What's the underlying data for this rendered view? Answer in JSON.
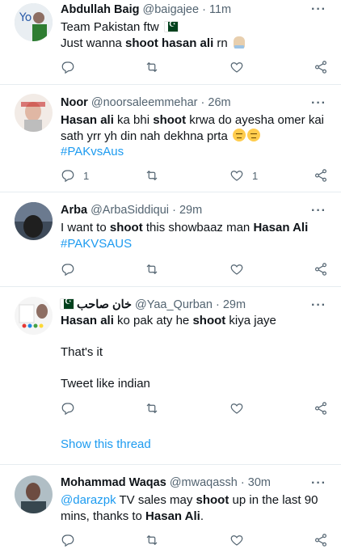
{
  "tweets": [
    {
      "name": "Abdullah Baig",
      "handle": "@baigajee",
      "time": "11m",
      "lines": [
        [
          {
            "t": "Team Pakistan ftw ",
            "s": ""
          },
          {
            "t": "pk-flag",
            "s": "flag"
          }
        ],
        [
          {
            "t": "Just wanna ",
            "s": ""
          },
          {
            "t": "shoot hasan ali",
            "s": "b"
          },
          {
            "t": " rn ",
            "s": ""
          },
          {
            "t": "folded-hands",
            "s": "hands"
          }
        ]
      ],
      "reply_count": "",
      "like_count": ""
    },
    {
      "name": "Noor",
      "handle": "@noorsaleemmehar",
      "time": "26m",
      "lines": [
        [
          {
            "t": "Hasan ali",
            "s": "b"
          },
          {
            "t": " ka bhi ",
            "s": ""
          },
          {
            "t": "shoot",
            "s": "b"
          },
          {
            "t": " krwa do ayesha omer kai",
            "s": ""
          }
        ],
        [
          {
            "t": "sath yrr yh din nah dekhna prta ",
            "s": ""
          },
          {
            "t": "relieved-face",
            "s": "face"
          },
          {
            "t": "relieved-face",
            "s": "face"
          }
        ],
        [
          {
            "t": "#PAKvsAus",
            "s": "link"
          }
        ]
      ],
      "reply_count": "1",
      "like_count": "1"
    },
    {
      "name": "Arba",
      "handle": "@ArbaSiddiqui",
      "time": "29m",
      "lines": [
        [
          {
            "t": "I want to ",
            "s": ""
          },
          {
            "t": "shoot",
            "s": "b"
          },
          {
            "t": " this showbaaz man ",
            "s": ""
          },
          {
            "t": "Hasan Ali",
            "s": "b"
          }
        ],
        [
          {
            "t": "#PAKVSAUS",
            "s": "link"
          }
        ]
      ],
      "reply_count": "",
      "like_count": ""
    },
    {
      "name": "خان صاحب",
      "handle": "@Yaa_Qurban",
      "time": "29m",
      "lines": [
        [
          {
            "t": "Hasan ali",
            "s": "b"
          },
          {
            "t": " ko pak aty he ",
            "s": ""
          },
          {
            "t": "shoot",
            "s": "b"
          },
          {
            "t": " kiya jaye",
            "s": ""
          }
        ],
        [],
        [
          {
            "t": "That's it",
            "s": ""
          }
        ],
        [],
        [
          {
            "t": "Tweet like indian",
            "s": ""
          }
        ]
      ],
      "reply_count": "",
      "like_count": ""
    },
    {
      "name": "Mohammad Waqas",
      "handle": "@mwaqassh",
      "time": "30m",
      "lines": [
        [
          {
            "t": "@darazpk",
            "s": "link"
          },
          {
            "t": " TV sales may ",
            "s": ""
          },
          {
            "t": "shoot",
            "s": "b"
          },
          {
            "t": " up in the last 90",
            "s": ""
          }
        ],
        [
          {
            "t": "mins, thanks to ",
            "s": ""
          },
          {
            "t": "Hasan Ali",
            "s": "b"
          },
          {
            "t": ".",
            "s": ""
          }
        ]
      ],
      "reply_count": "",
      "like_count": ""
    }
  ],
  "show_thread_label": "Show this thread",
  "separator": "·",
  "more_label": "···",
  "colors": {
    "text": "#0f1419",
    "secondary": "#536471",
    "link": "#1d9bf0",
    "divider": "#e6ecf0"
  },
  "icons": [
    "reply-icon",
    "retweet-icon",
    "like-icon",
    "share-icon",
    "more-icon"
  ]
}
